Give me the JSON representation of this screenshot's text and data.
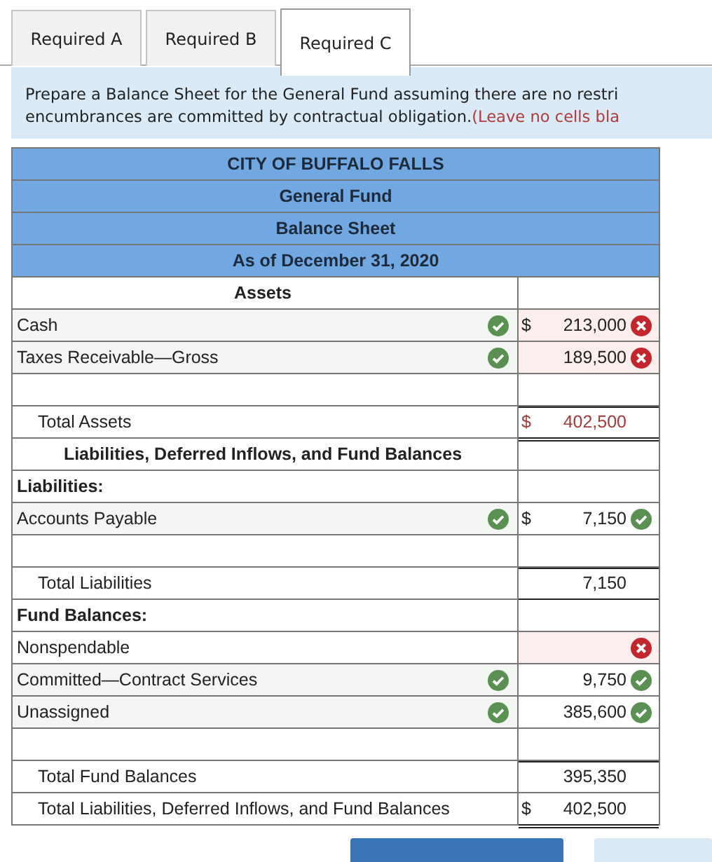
{
  "tabs": [
    {
      "label": "Required A",
      "selected": false
    },
    {
      "label": "Required B",
      "selected": false
    },
    {
      "label": "Required C",
      "selected": true
    }
  ],
  "instructions": {
    "line_1": "Prepare a Balance Sheet for the General Fund assuming there are no restri",
    "line_2": "encumbrances are committed by contractual obligation.",
    "hint": "(Leave no cells bla"
  },
  "balance_sheet": {
    "headers": [
      "CITY OF BUFFALO FALLS",
      "General Fund",
      "Balance Sheet",
      "As of December 31, 2020"
    ],
    "rows": [
      {
        "kind": "section",
        "label": "Assets"
      },
      {
        "kind": "item",
        "label": "Cash",
        "label_check": true,
        "dollar": "$",
        "value": "213,000",
        "value_correct": false
      },
      {
        "kind": "item",
        "label": "Taxes Receivable—Gross",
        "label_check": true,
        "value": "189,500",
        "value_correct": false
      },
      {
        "kind": "blank"
      },
      {
        "kind": "total",
        "label": "Total Assets",
        "dollar": "$",
        "value": "402,500",
        "flagged": true,
        "rule_above": true,
        "rule_below": true,
        "double": true
      },
      {
        "kind": "section",
        "label": "Liabilities, Deferred Inflows, and Fund Balances"
      },
      {
        "kind": "heading",
        "label": "Liabilities:"
      },
      {
        "kind": "item",
        "label": "Accounts Payable",
        "label_check": true,
        "dollar": "$",
        "value": "7,150",
        "value_correct": true
      },
      {
        "kind": "blank"
      },
      {
        "kind": "total",
        "label": "Total Liabilities",
        "value": "7,150",
        "flagged": false,
        "rule_above": true,
        "rule_below": true,
        "double": false
      },
      {
        "kind": "heading",
        "label": "Fund Balances:"
      },
      {
        "kind": "item",
        "label": "Nonspendable",
        "label_check": false,
        "value_correct": false
      },
      {
        "kind": "item",
        "label": "Committed—Contract Services",
        "label_check": true,
        "value": "9,750",
        "value_correct": true
      },
      {
        "kind": "item",
        "label": "Unassigned",
        "label_check": true,
        "value": "385,600",
        "value_correct": true
      },
      {
        "kind": "blank"
      },
      {
        "kind": "total",
        "label": "Total Fund Balances",
        "value": "395,350",
        "flagged": false,
        "rule_above": true,
        "rule_below": false
      },
      {
        "kind": "total",
        "label": "Total Liabilities, Deferred Inflows, and Fund Balances",
        "dollar": "$",
        "value": "402,500",
        "flagged": false,
        "rule_above": false,
        "rule_below": true,
        "double": true
      }
    ]
  },
  "nav_buttons": [
    {
      "kind": "primary"
    },
    {
      "kind": "secondary"
    }
  ]
}
